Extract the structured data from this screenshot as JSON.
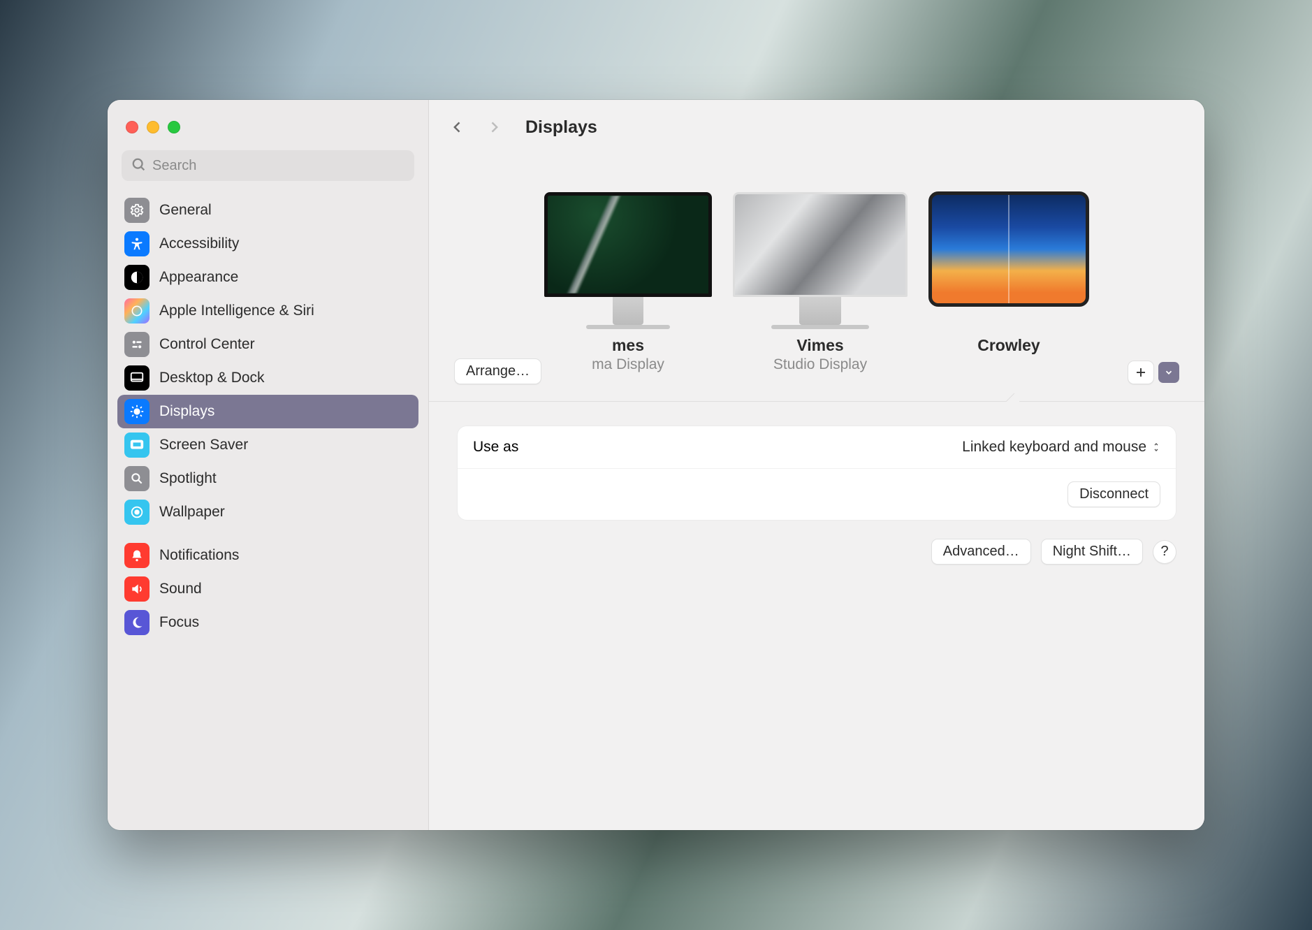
{
  "search": {
    "placeholder": "Search"
  },
  "page": {
    "title": "Displays"
  },
  "sidebar": {
    "items": [
      {
        "label": "General",
        "icon": "gear-icon",
        "bg": "#8e8e93"
      },
      {
        "label": "Accessibility",
        "icon": "accessibility-icon",
        "bg": "#0a7aff"
      },
      {
        "label": "Appearance",
        "icon": "appearance-icon",
        "bg": "#000000"
      },
      {
        "label": "Apple Intelligence & Siri",
        "icon": "siri-icon",
        "bg": "linear-gradient(135deg,#ff6aa1,#ffb259,#4fd1ff,#a06bff)"
      },
      {
        "label": "Control Center",
        "icon": "control-center-icon",
        "bg": "#8e8e93"
      },
      {
        "label": "Desktop & Dock",
        "icon": "desktop-dock-icon",
        "bg": "#000000"
      },
      {
        "label": "Displays",
        "icon": "displays-icon",
        "bg": "#0a7aff",
        "selected": true
      },
      {
        "label": "Screen Saver",
        "icon": "screen-saver-icon",
        "bg": "#35c5ef"
      },
      {
        "label": "Spotlight",
        "icon": "spotlight-icon",
        "bg": "#8e8e93"
      },
      {
        "label": "Wallpaper",
        "icon": "wallpaper-icon",
        "bg": "#35c5ef"
      }
    ],
    "group2": [
      {
        "label": "Notifications",
        "icon": "notifications-icon",
        "bg": "#ff3b30"
      },
      {
        "label": "Sound",
        "icon": "sound-icon",
        "bg": "#ff3b30"
      },
      {
        "label": "Focus",
        "icon": "focus-icon",
        "bg": "#5856d6"
      }
    ]
  },
  "displays": [
    {
      "name": "mes",
      "sub": "ma Display"
    },
    {
      "name": "Vimes",
      "sub": "Studio Display"
    },
    {
      "name": "Crowley",
      "sub": ""
    }
  ],
  "buttons": {
    "arrange": "Arrange…",
    "advanced": "Advanced…",
    "night_shift": "Night Shift…",
    "disconnect": "Disconnect",
    "help": "?"
  },
  "settings": {
    "use_as_label": "Use as",
    "use_as_value": "Linked keyboard and mouse"
  }
}
